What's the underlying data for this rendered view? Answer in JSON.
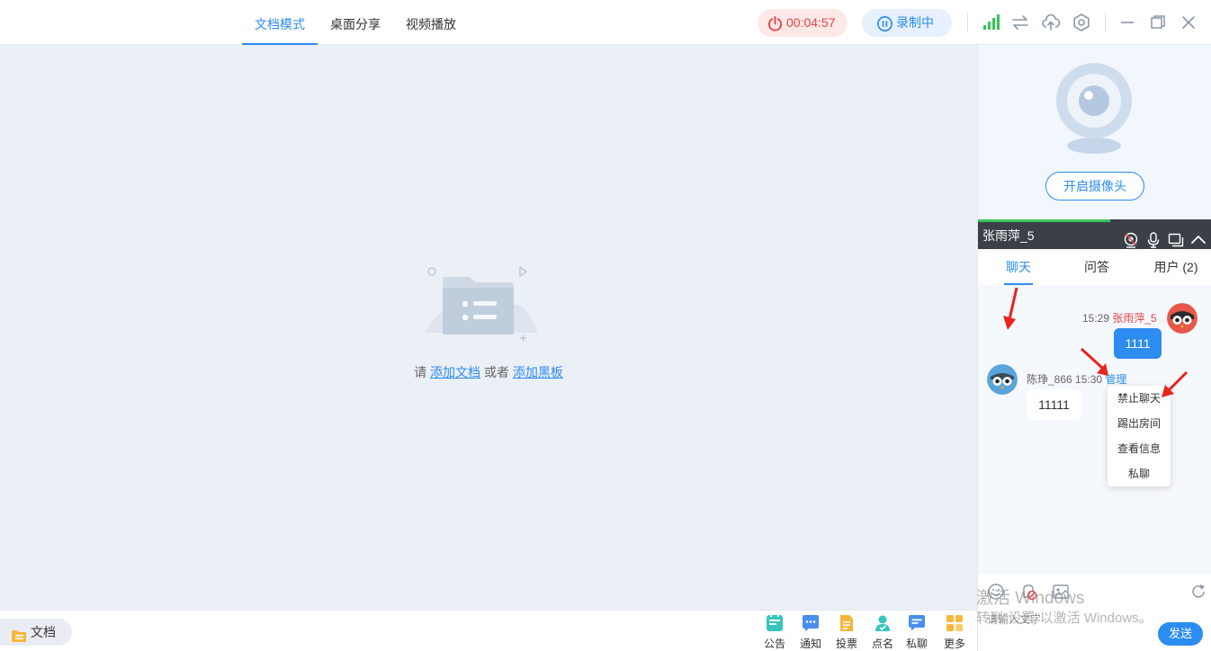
{
  "mode_tabs": [
    {
      "label": "文档模式",
      "active": true
    },
    {
      "label": "桌面分享",
      "active": false
    },
    {
      "label": "视频播放",
      "active": false
    }
  ],
  "header": {
    "timer": "00:04:57",
    "record_label": "录制中"
  },
  "empty_state": {
    "prefix": "请",
    "add_doc": "添加文档",
    "or": "或者",
    "add_board": "添加黑板"
  },
  "bottom": {
    "doc_label": "文档",
    "tools": [
      {
        "label": "公告",
        "icon": "announcement-icon",
        "color": "#36c5c0"
      },
      {
        "label": "通知",
        "icon": "notification-icon",
        "color": "#4a8ff0"
      },
      {
        "label": "投票",
        "icon": "vote-icon",
        "color": "#f5b73b"
      },
      {
        "label": "点名",
        "icon": "roll-call-icon",
        "color": "#36c5c0"
      },
      {
        "label": "私聊",
        "icon": "private-chat-icon",
        "color": "#4a8ff0"
      },
      {
        "label": "更多",
        "icon": "more-icon",
        "color": "#f5b73b"
      }
    ]
  },
  "camera": {
    "button_label": "开启摄像头"
  },
  "user_bar": {
    "name": "张雨萍_5"
  },
  "chat_tabs": [
    {
      "label": "聊天",
      "active": true
    },
    {
      "label": "问答",
      "active": false
    },
    {
      "label": "用户 (2)",
      "active": false
    }
  ],
  "messages": [
    {
      "time": "15:29",
      "name": "张雨萍_5",
      "text": "1111",
      "self": true
    },
    {
      "name": "陈琤_866",
      "time": "15:30",
      "manage": "管理",
      "text": "11111",
      "self": false
    }
  ],
  "context_menu": [
    "禁止聊天",
    "踢出房间",
    "查看信息",
    "私聊"
  ],
  "input": {
    "placeholder": "请输入文字",
    "send_label": "发送"
  },
  "watermark": {
    "line1": "激活 Windows",
    "line2": "转到\"设置\"以激活 Windows。"
  },
  "colors": {
    "accent": "#2d8cf0",
    "danger": "#e54545",
    "signal": "#35c759"
  }
}
